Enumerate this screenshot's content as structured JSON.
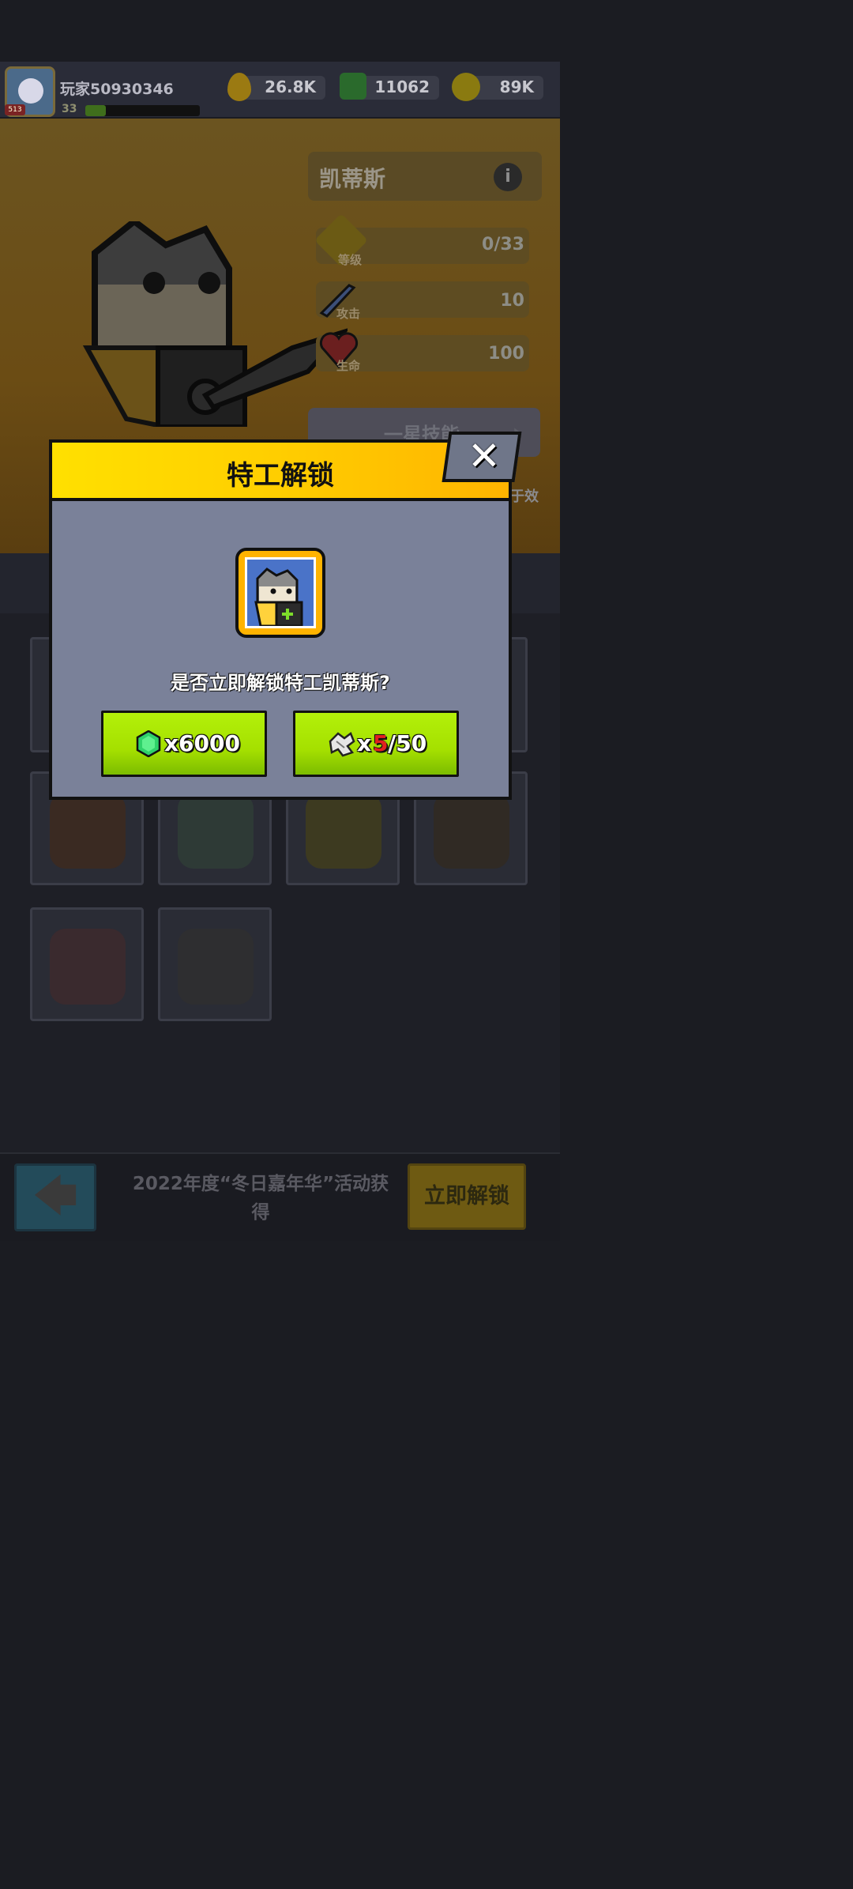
{
  "player": {
    "name": "玩家50930346",
    "level": "33",
    "xp_fraction": 0.18
  },
  "resources": [
    {
      "icon": "drop-icon",
      "value": "26.8K",
      "color": "#d7a400"
    },
    {
      "icon": "gem-plus-icon",
      "value": "11062",
      "color": "#2fb24a"
    },
    {
      "icon": "coin-plus-icon",
      "value": "89K",
      "color": "#d7b600"
    }
  ],
  "agent": {
    "name": "凯蒂斯",
    "stats": [
      {
        "label": "等级",
        "icon": "star-badge-icon",
        "value": "0/33"
      },
      {
        "label": "攻击",
        "icon": "sword-icon",
        "value": "10"
      },
      {
        "label": "生命",
        "icon": "heart-icon",
        "value": "100"
      }
    ],
    "skill_label": "一星技能",
    "effect_text": "于效"
  },
  "dialog": {
    "title": "特工解锁",
    "question": "是否立即解锁特工凯蒂斯?",
    "gem_cost": "x6000",
    "shard_prefix": "x",
    "shard_have": "5",
    "shard_need": "/50"
  },
  "footer": {
    "event_text": "2022年度“冬日嘉年华”活动获得",
    "unlock_now_label": "立即解锁",
    "back_label": "🡄"
  },
  "colors": {
    "dialog_header": "#ffd000",
    "dialog_body": "#7a8199",
    "green_button": "#a5e000",
    "shard_have": "#e12020"
  }
}
